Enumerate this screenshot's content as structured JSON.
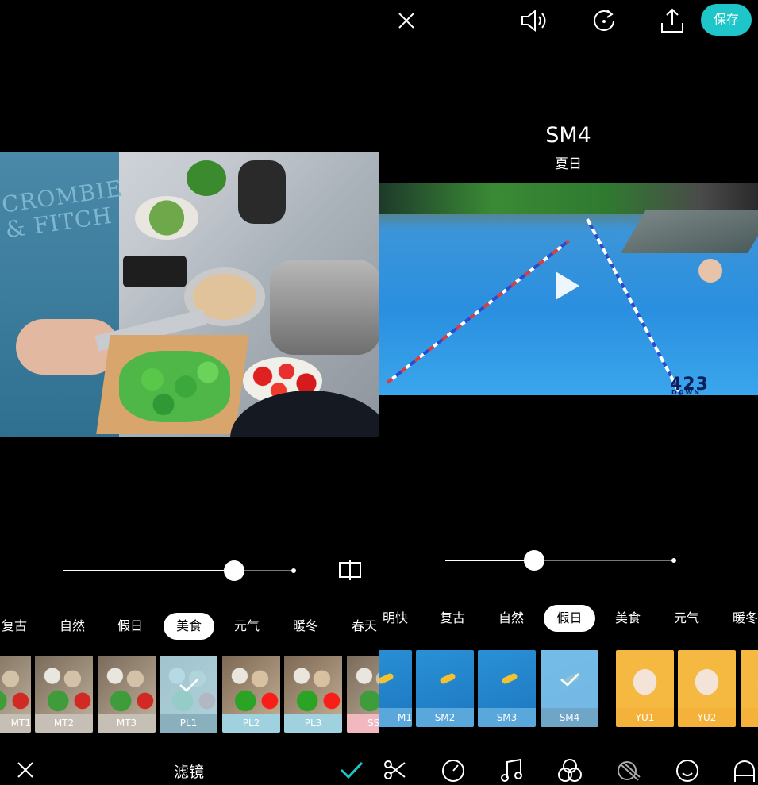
{
  "left_panel": {
    "photo_shirt_text": "CROMBIE\n& FITCH",
    "categories": [
      "复古",
      "自然",
      "假日",
      "美食",
      "元气",
      "暖冬",
      "春天"
    ],
    "active_category": "美食",
    "filter_slider_value": 0.74,
    "filters": [
      {
        "label": "MT1",
        "selected": false
      },
      {
        "label": "MT2",
        "selected": false
      },
      {
        "label": "MT3",
        "selected": false
      },
      {
        "label": "PL1",
        "selected": true
      },
      {
        "label": "PL2",
        "selected": false
      },
      {
        "label": "PL3",
        "selected": false
      },
      {
        "label": "SS",
        "selected": false
      }
    ],
    "bottom_bar": {
      "title": "滤镜"
    },
    "icons": {
      "compare": "compare-icon",
      "cancel": "close-icon",
      "confirm": "check-icon"
    },
    "colors": {
      "confirm": "#1fc6c9",
      "mt_label_bg": "#c6bfb6",
      "pl_label_bg": "#9fd1de",
      "ss_label_bg": "#f2b8c0"
    }
  },
  "right_panel": {
    "topbar": {
      "save_label": "保存"
    },
    "icons": {
      "close": "close-icon",
      "sound": "speaker-icon",
      "replay": "replay-icon",
      "share": "share-icon"
    },
    "filter_name": "SM4",
    "filter_category": "夏日",
    "video_watermark": "423",
    "video_watermark_sub": "DOWN",
    "filter_slider_value": 0.39,
    "categories": [
      "明快",
      "复古",
      "自然",
      "假日",
      "美食",
      "元气",
      "暖冬"
    ],
    "active_category": "假日",
    "filters": [
      {
        "label": "M1",
        "selected": false
      },
      {
        "label": "SM2",
        "selected": false
      },
      {
        "label": "SM3",
        "selected": false
      },
      {
        "label": "SM4",
        "selected": true
      },
      {
        "label": "YU1",
        "selected": false
      },
      {
        "label": "YU2",
        "selected": false
      },
      {
        "label": "",
        "selected": false
      }
    ],
    "toolbar_icons": [
      "scissors-icon",
      "speed-icon",
      "music-icon",
      "filter-icon",
      "adjust-icon",
      "sticker-icon",
      "more-icon"
    ],
    "colors": {
      "save_bg": "#1fc6c9",
      "sm_label_bg": "#5aa7dc",
      "yu_label_bg": "#f4b23a"
    }
  }
}
